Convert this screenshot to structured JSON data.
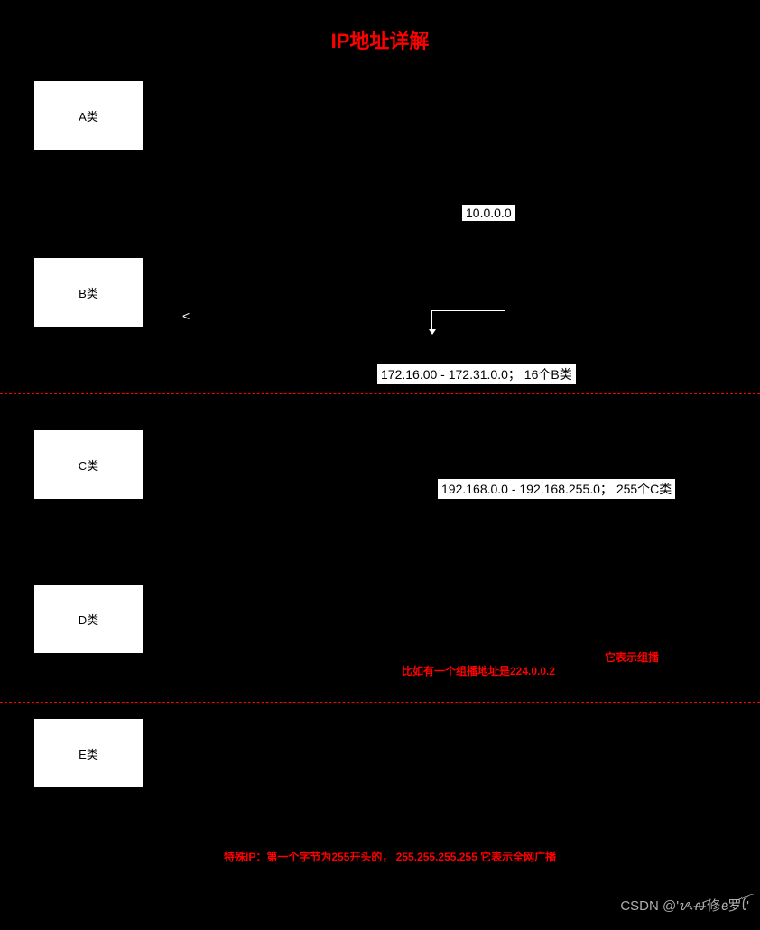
{
  "title": "IP地址详解",
  "classes": {
    "a": {
      "label": "A类",
      "badge": "10.0.0.0"
    },
    "b": {
      "label": "B类",
      "angle": "<",
      "badge": "172.16.00 - 172.31.0.0； 16个B类"
    },
    "c": {
      "label": "C类",
      "badge": "192.168.0.0 - 192.168.255.0； 255个C类"
    },
    "d": {
      "label": "D类",
      "note1": "比如有一个组播地址是224.0.0.2",
      "note2": "它表示组播"
    },
    "e": {
      "label": "E类"
    }
  },
  "special_ip": "特殊IP：第一个字节为255开头的， 255.255.255.255  它表示全网广播",
  "watermark": "CSDN @'ᝰꫛ修ꫀ罗ꪶꪸ'"
}
